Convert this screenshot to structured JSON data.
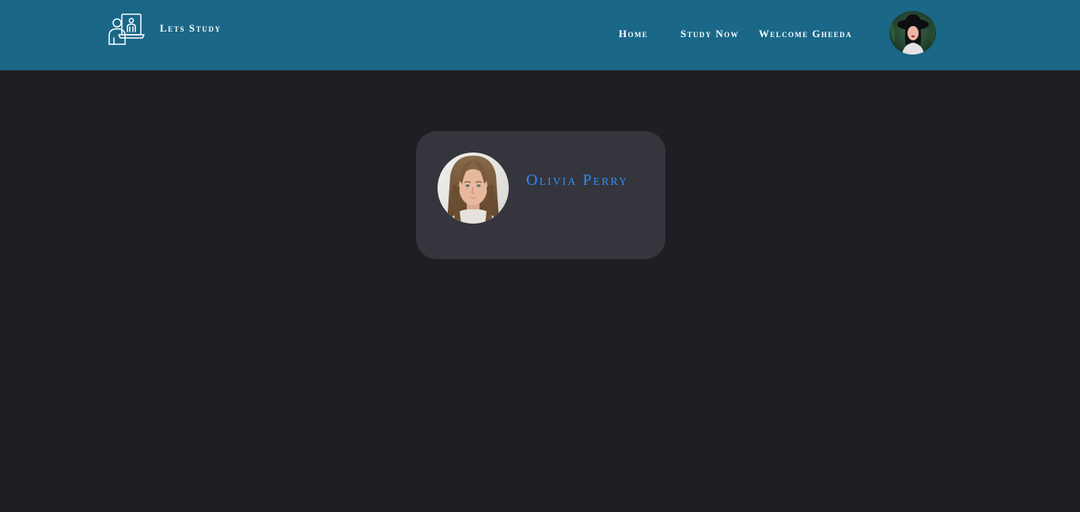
{
  "navbar": {
    "brand": {
      "name": "Lets Study",
      "logo_icon": "student-laptop-icon"
    },
    "links": {
      "home": "Home",
      "study_now": "Study Now",
      "welcome": "Welcome Gheeda"
    },
    "user_avatar_icon": "user-avatar",
    "background_color": "#1a6788"
  },
  "profile_card": {
    "name": "Olivia Perry",
    "avatar_icon": "profile-photo",
    "name_color": "#2e8ef2",
    "background_color": "#35353e"
  },
  "page": {
    "background_color": "#1f1e23"
  }
}
